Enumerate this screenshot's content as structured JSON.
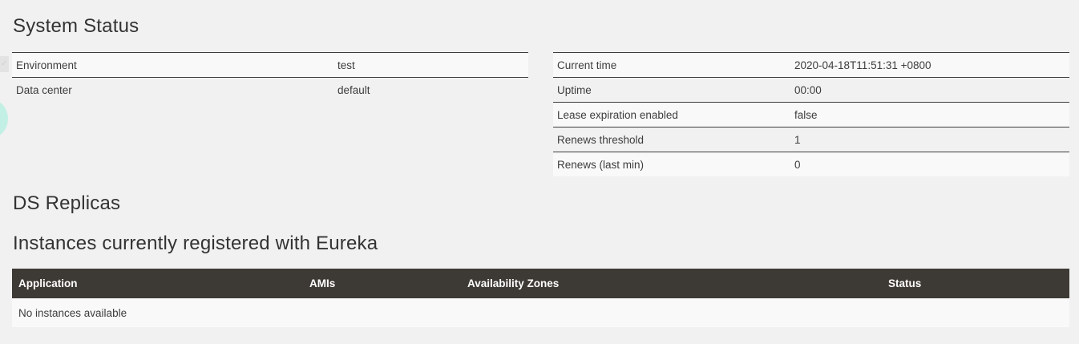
{
  "system_status": {
    "title": "System Status",
    "environment": [
      {
        "label": "Environment",
        "value": "test"
      },
      {
        "label": "Data center",
        "value": "default"
      }
    ],
    "runtime": [
      {
        "label": "Current time",
        "value": "2020-04-18T11:51:31 +0800"
      },
      {
        "label": "Uptime",
        "value": "00:00"
      },
      {
        "label": "Lease expiration enabled",
        "value": "false"
      },
      {
        "label": "Renews threshold",
        "value": "1"
      },
      {
        "label": "Renews (last min)",
        "value": "0"
      }
    ]
  },
  "ds_replicas": {
    "title": "DS Replicas"
  },
  "instances": {
    "title": "Instances currently registered with Eureka",
    "columns": [
      "Application",
      "AMIs",
      "Availability Zones",
      "Status"
    ],
    "empty_message": "No instances available"
  },
  "colors": {
    "header_bg": "#3d3934",
    "page_bg": "#f1f1f1",
    "row_light": "#f9f9f9",
    "accent_blob": "#b6f0e1"
  },
  "icons": {
    "side_tab": "check-icon"
  }
}
